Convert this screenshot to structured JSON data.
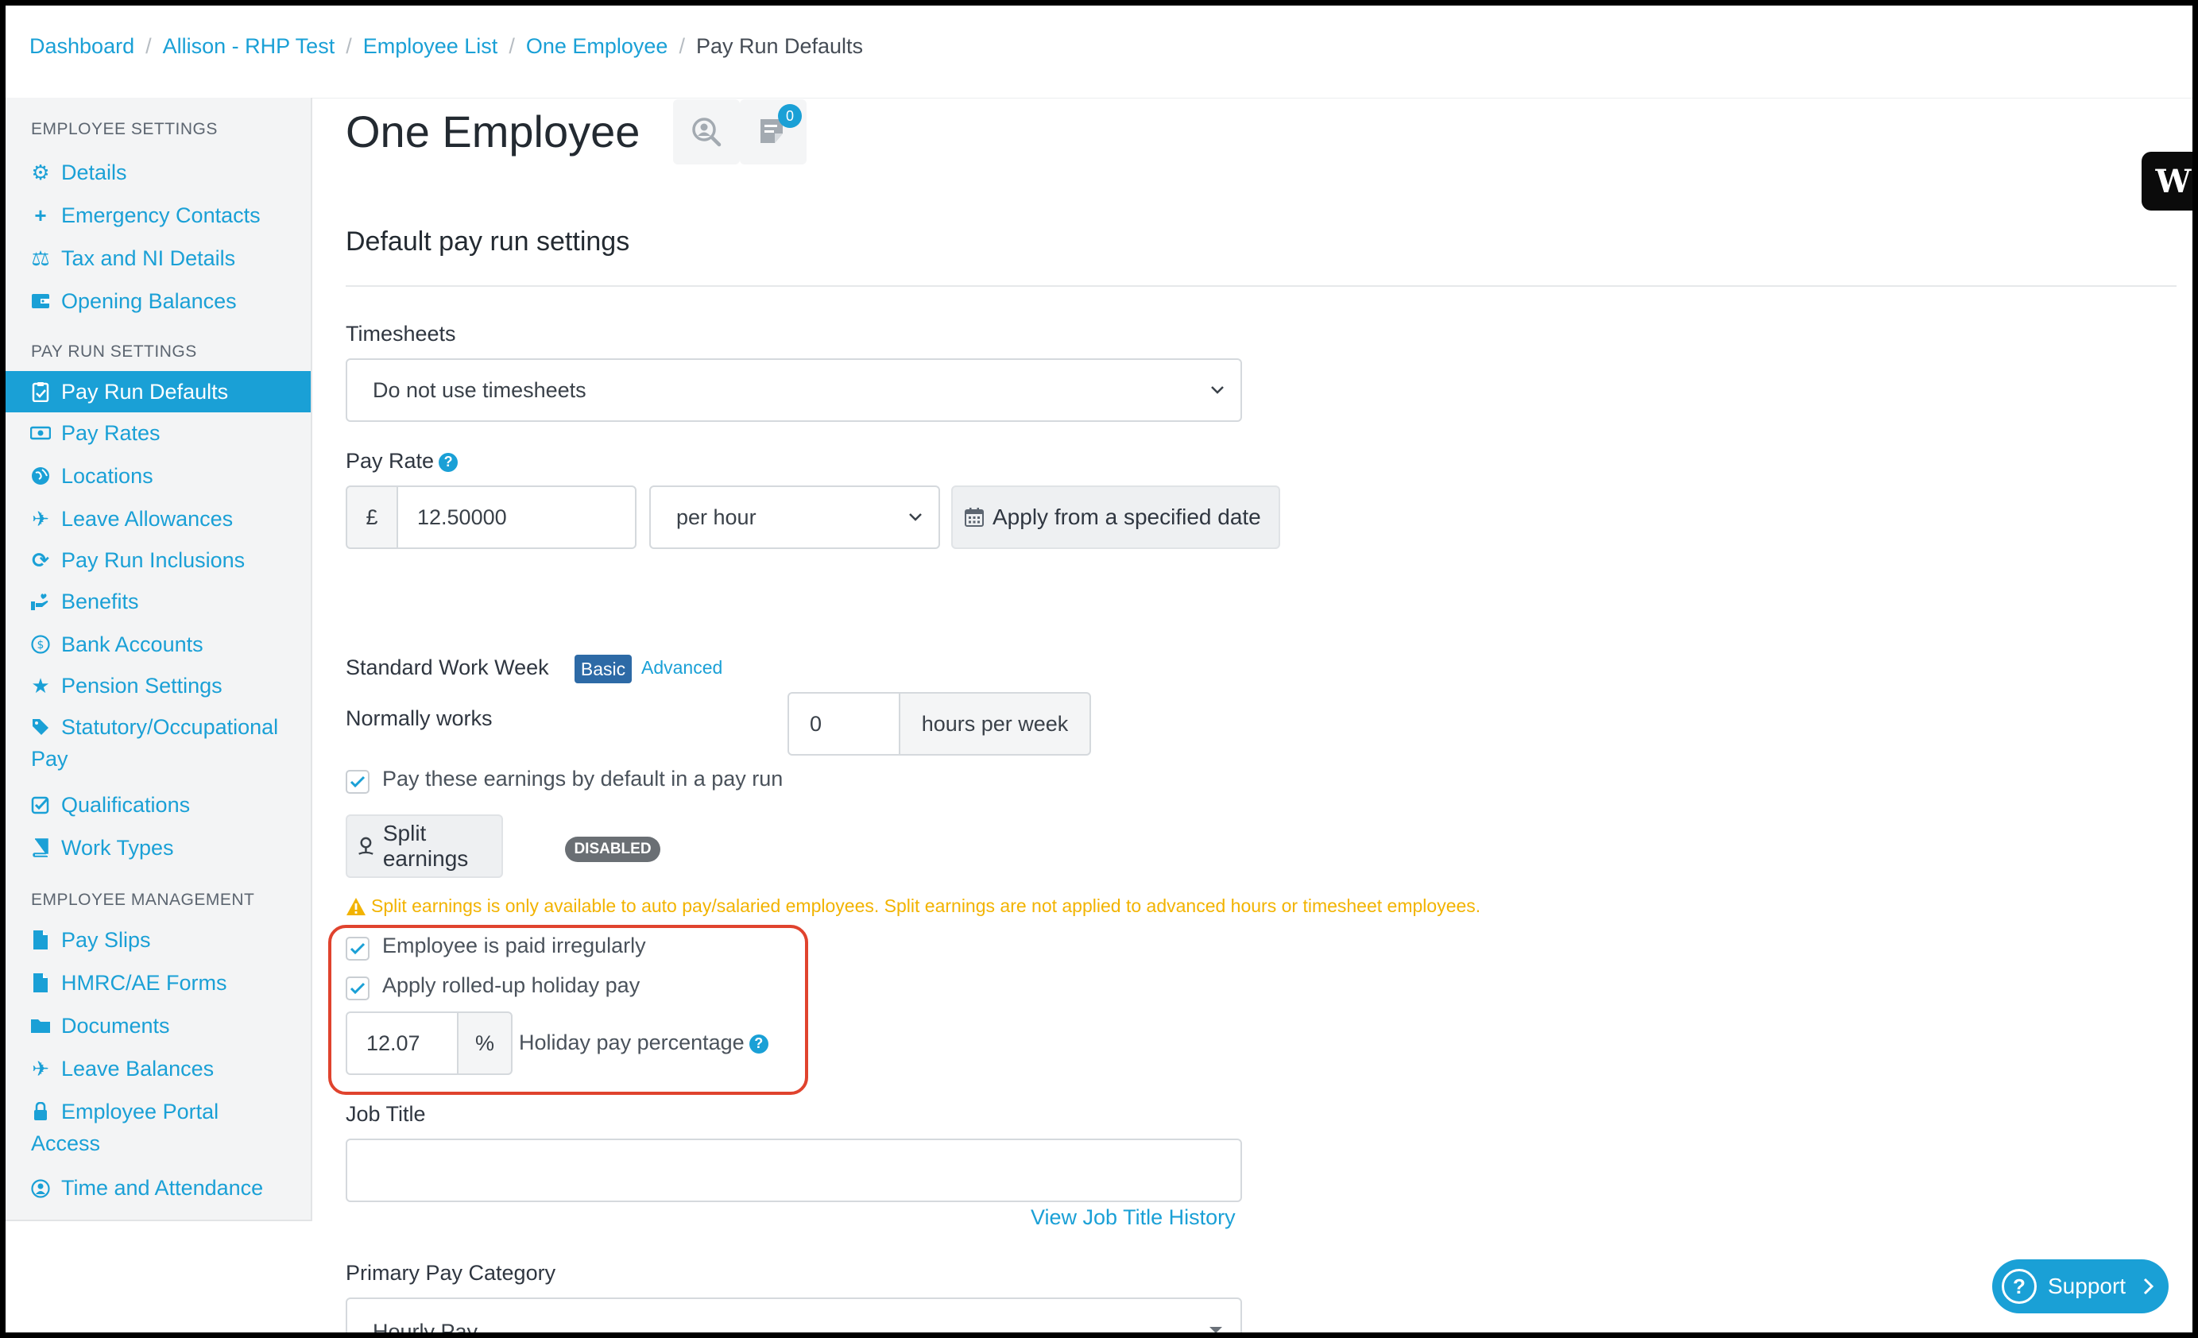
{
  "breadcrumb": [
    "Dashboard",
    "Allison - RHP Test",
    "Employee List",
    "One Employee"
  ],
  "breadcrumb_current": "Pay Run Defaults",
  "sidebar": {
    "employee_settings_heading": "EMPLOYEE SETTINGS",
    "employee_settings": [
      "Details",
      "Emergency Contacts",
      "Tax and NI Details",
      "Opening Balances"
    ],
    "pay_run_settings_heading": "PAY RUN SETTINGS",
    "pay_run_settings": [
      "Pay Run Defaults",
      "Pay Rates",
      "Locations",
      "Leave Allowances",
      "Pay Run Inclusions",
      "Benefits",
      "Bank Accounts",
      "Pension Settings",
      "Statutory/Occupational",
      "Pay",
      "Qualifications",
      "Work Types"
    ],
    "employee_management_heading": "EMPLOYEE MANAGEMENT",
    "employee_management": [
      "Pay Slips",
      "HMRC/AE Forms",
      "Documents",
      "Leave Balances",
      "Employee Portal",
      "Access",
      "Time and Attendance"
    ]
  },
  "main": {
    "title": "One Employee",
    "notes_count": "0",
    "section_title": "Default pay run settings",
    "timesheets_label": "Timesheets",
    "timesheets_value": "Do not use timesheets",
    "pay_rate_label": "Pay Rate",
    "currency_symbol": "£",
    "pay_rate_value": "12.50000",
    "pay_rate_unit": "per hour",
    "apply_date_button": "Apply from a specified date",
    "work_week_label": "Standard Work Week",
    "basic_tag": "Basic",
    "advanced_link": "Advanced",
    "normally_works_label": "Normally works",
    "hours_value": "0",
    "hours_unit": "hours per week",
    "pay_earnings_default": "Pay these earnings by default in a pay run",
    "split_earnings_button": "Split earnings",
    "disabled_tag": "DISABLED",
    "split_warning": "Split earnings is only available to auto pay/salaried employees. Split earnings are not applied to advanced hours or timesheet employees.",
    "paid_irregularly": "Employee is paid irregularly",
    "rolled_up_holiday": "Apply rolled-up holiday pay",
    "holiday_pct_value": "12.07",
    "percent_symbol": "%",
    "holiday_pct_label": "Holiday pay percentage",
    "job_title_label": "Job Title",
    "job_title_value": "",
    "job_title_history_link": "View Job Title History",
    "primary_pay_category_label": "Primary Pay Category",
    "primary_pay_category_value": "Hourly Pay"
  },
  "widgets": {
    "w_tab": "W",
    "support_label": "Support"
  },
  "colors": {
    "accent": "#1aa0d6",
    "warning": "#f2b300",
    "highlight": "#e0432e",
    "basic_tag": "#2d6aa6"
  }
}
